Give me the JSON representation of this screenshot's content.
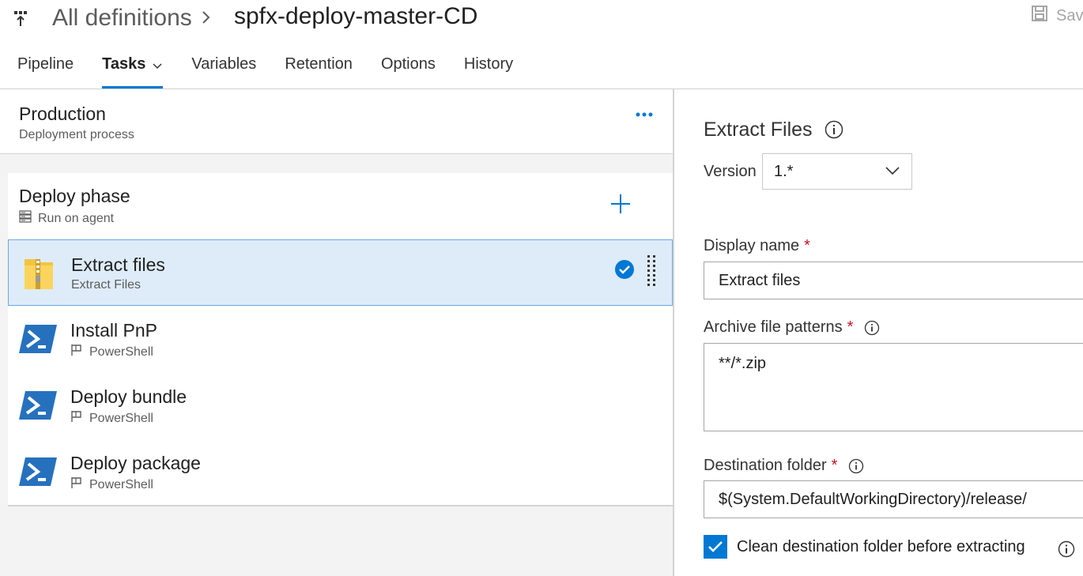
{
  "breadcrumb": {
    "root": "All definitions",
    "separator": ">",
    "title": "spfx-deploy-master-CD"
  },
  "toolbar": {
    "save_label": "Sav"
  },
  "tabs": [
    {
      "label": "Pipeline",
      "active": false
    },
    {
      "label": "Tasks",
      "active": true,
      "has_dropdown": true
    },
    {
      "label": "Variables",
      "active": false
    },
    {
      "label": "Retention",
      "active": false
    },
    {
      "label": "Options",
      "active": false
    },
    {
      "label": "History",
      "active": false
    }
  ],
  "stage": {
    "title": "Production",
    "subtitle": "Deployment process"
  },
  "phase": {
    "title": "Deploy phase",
    "subtitle": "Run on agent"
  },
  "tasks": [
    {
      "name": "Extract files",
      "type": "Extract Files",
      "icon": "zip-archive-icon",
      "selected": true
    },
    {
      "name": "Install PnP",
      "type": "PowerShell",
      "icon": "powershell-icon",
      "selected": false
    },
    {
      "name": "Deploy bundle",
      "type": "PowerShell",
      "icon": "powershell-icon",
      "selected": false
    },
    {
      "name": "Deploy package",
      "type": "PowerShell",
      "icon": "powershell-icon",
      "selected": false
    }
  ],
  "details": {
    "title": "Extract Files",
    "version_label": "Version",
    "version_value": "1.*",
    "display_name": {
      "label": "Display name",
      "required": "*",
      "value": "Extract files"
    },
    "archive_patterns": {
      "label": "Archive file patterns",
      "required": "*",
      "value": "**/*.zip"
    },
    "destination_folder": {
      "label": "Destination folder",
      "required": "*",
      "value": "$(System.DefaultWorkingDirectory)/release/"
    },
    "clean_destination": {
      "label": "Clean destination folder before extracting",
      "checked": true
    }
  },
  "colors": {
    "accent": "#0078d4",
    "selected_bg": "#deecf9",
    "required": "#c50f1f",
    "panel_bg": "#f3f3f3"
  }
}
